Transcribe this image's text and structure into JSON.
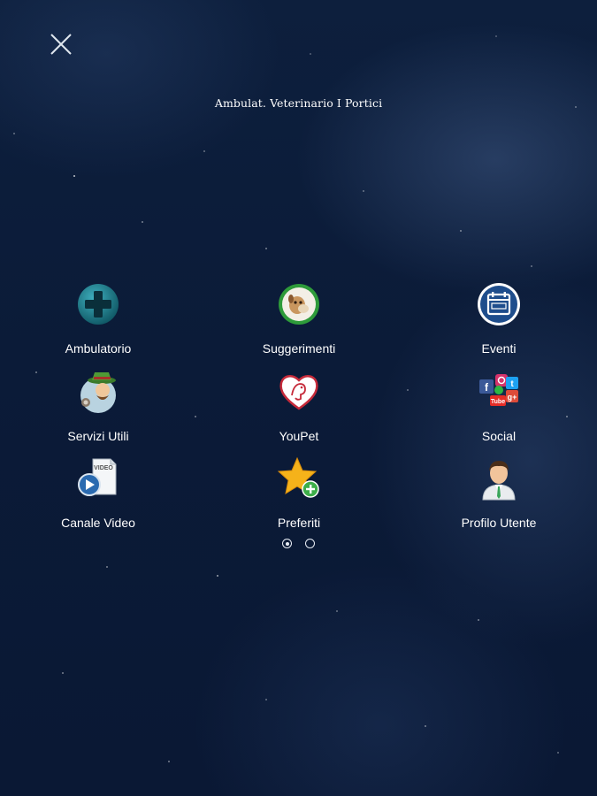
{
  "header": {
    "title": "Ambulat. Veterinario I Portici"
  },
  "menu": {
    "items": [
      {
        "label": "Ambulatorio",
        "icon": "medical-cross-icon"
      },
      {
        "label": "Suggerimenti",
        "icon": "pet-photo-icon"
      },
      {
        "label": "Eventi",
        "icon": "calendar-icon"
      },
      {
        "label": "Servizi Utili",
        "icon": "services-hat-icon"
      },
      {
        "label": "YouPet",
        "icon": "heart-pet-icon"
      },
      {
        "label": "Social",
        "icon": "social-networks-icon"
      },
      {
        "label": "Canale Video",
        "icon": "video-icon"
      },
      {
        "label": "Preferiti",
        "icon": "star-add-icon"
      },
      {
        "label": "Profilo Utente",
        "icon": "user-profile-icon"
      }
    ]
  },
  "pagination": {
    "pages": 2,
    "current": 1
  },
  "colors": {
    "background": "#0b1b38",
    "text": "#ffffff",
    "accent_teal": "#1d7f8f",
    "accent_green": "#2e9b3a"
  }
}
